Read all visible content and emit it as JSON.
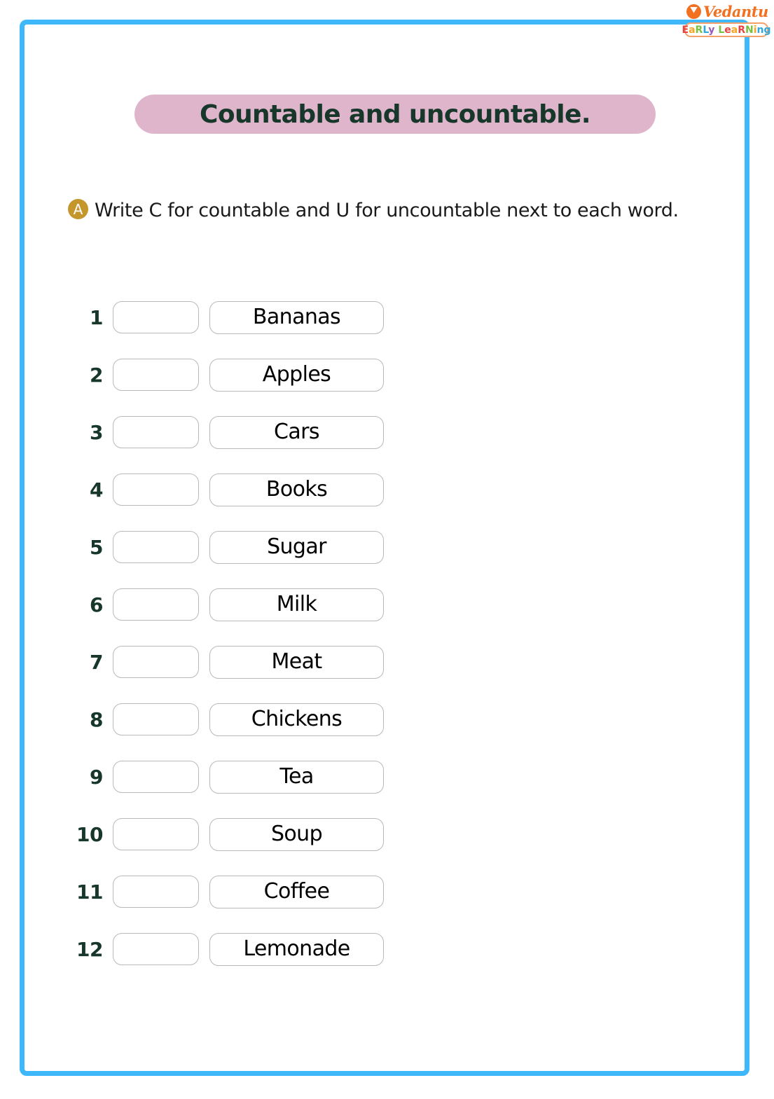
{
  "logo": {
    "brand": "Vedantu",
    "tagline_letters": [
      {
        "char": "E",
        "color": "#e8423f"
      },
      {
        "char": "a",
        "color": "#f6a623"
      },
      {
        "char": "R",
        "color": "#7ac143"
      },
      {
        "char": "L",
        "color": "#2fa8e0"
      },
      {
        "char": "y",
        "color": "#9b59b6"
      },
      {
        "char": " ",
        "color": "#ffffff"
      },
      {
        "char": "L",
        "color": "#7ac143"
      },
      {
        "char": "e",
        "color": "#e8423f"
      },
      {
        "char": "a",
        "color": "#f6a623"
      },
      {
        "char": "R",
        "color": "#e8423f"
      },
      {
        "char": "N",
        "color": "#7ac143"
      },
      {
        "char": "i",
        "color": "#f6a623"
      },
      {
        "char": "n",
        "color": "#2fa8e0"
      },
      {
        "char": "g",
        "color": "#2fa8e0"
      }
    ],
    "v_mark_icon": "vedantu-v-icon"
  },
  "title": "Countable and uncountable.",
  "instruction": {
    "badge": "A",
    "text": "Write C for countable and U for uncountable next to each word."
  },
  "questions": [
    {
      "number": "1",
      "word": "Bananas",
      "answer": ""
    },
    {
      "number": "2",
      "word": "Apples",
      "answer": ""
    },
    {
      "number": "3",
      "word": "Cars",
      "answer": ""
    },
    {
      "number": "4",
      "word": "Books",
      "answer": ""
    },
    {
      "number": "5",
      "word": "Sugar",
      "answer": ""
    },
    {
      "number": "6",
      "word": "Milk",
      "answer": ""
    },
    {
      "number": "7",
      "word": "Meat",
      "answer": ""
    },
    {
      "number": "8",
      "word": "Chickens",
      "answer": ""
    },
    {
      "number": "9",
      "word": "Tea",
      "answer": ""
    },
    {
      "number": "10",
      "word": "Soup",
      "answer": ""
    },
    {
      "number": "11",
      "word": "Coffee",
      "answer": ""
    },
    {
      "number": "12",
      "word": "Lemonade",
      "answer": ""
    }
  ],
  "colors": {
    "frame_blue": "#3fb7fb",
    "banner_pink": "#dfb5cc",
    "title_green": "#17372b",
    "badge_gold": "#c4962c",
    "box_border": "#b9b9b9",
    "brand_orange": "#f37021"
  }
}
